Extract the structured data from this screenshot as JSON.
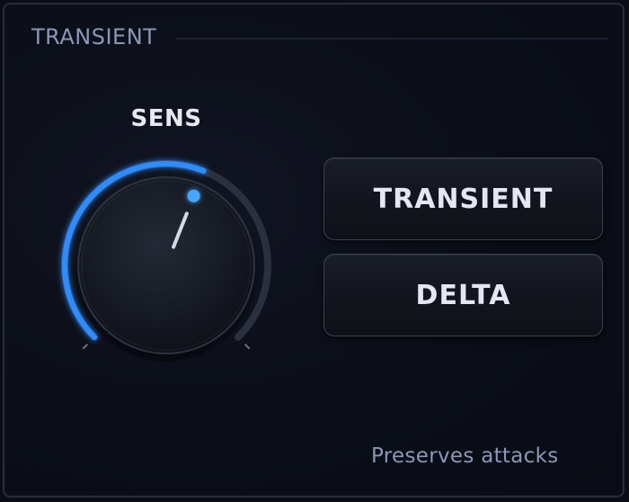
{
  "section": {
    "title": "TRANSIENT"
  },
  "knob": {
    "label": "SENS",
    "value": 0.58,
    "accent_color": "#2f8cff",
    "track_color": "#2a303d"
  },
  "buttons": {
    "transient_label": "TRANSIENT",
    "delta_label": "DELTA"
  },
  "status": {
    "text": "Preserves attacks"
  }
}
